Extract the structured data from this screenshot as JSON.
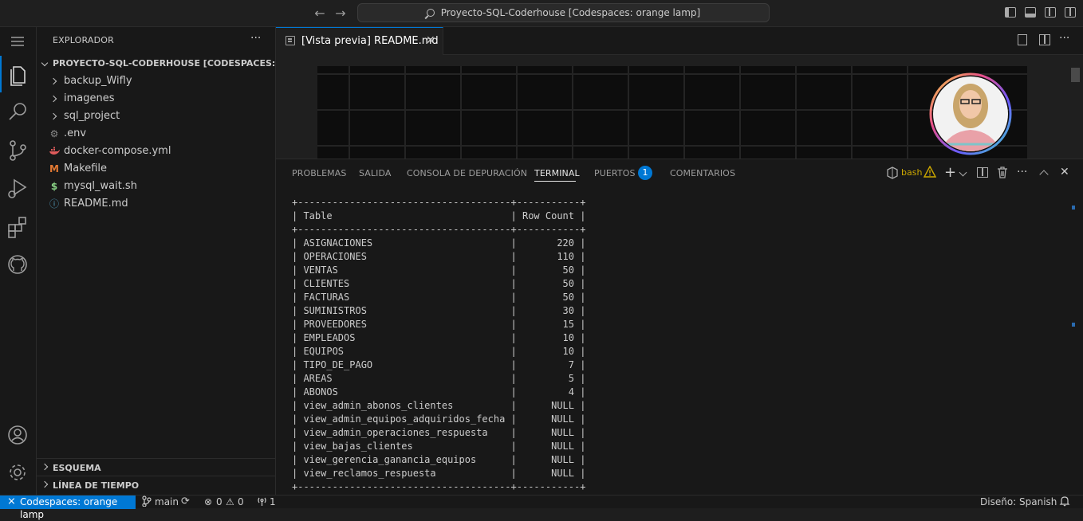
{
  "titlebar": {
    "search_text": "Proyecto-SQL-Coderhouse [Codespaces: orange lamp]"
  },
  "sidebar": {
    "title": "EXPLORADOR",
    "more": "···",
    "root_folder": "PROYECTO-SQL-CODERHOUSE [CODESPACES: ORA...",
    "items": [
      {
        "label": "backup_Wifly",
        "type": "folder"
      },
      {
        "label": "imagenes",
        "type": "folder"
      },
      {
        "label": "sql_project",
        "type": "folder"
      },
      {
        "label": ".env",
        "type": "gear-icon"
      },
      {
        "label": "docker-compose.yml",
        "type": "docker-icon"
      },
      {
        "label": "Makefile",
        "type": "makefile-icon",
        "glyph": "M"
      },
      {
        "label": "mysql_wait.sh",
        "type": "shell-icon",
        "glyph": "$"
      },
      {
        "label": "README.md",
        "type": "info-icon",
        "glyph": "ⓘ"
      }
    ],
    "outline": "ESQUEMA",
    "timeline": "LÍNEA DE TIEMPO"
  },
  "editor": {
    "tab_label": "[Vista previa] README.md",
    "tab_close": "✕"
  },
  "panel": {
    "tabs": [
      "PROBLEMAS",
      "SALIDA",
      "CONSOLA DE DEPURACIÓN",
      "TERMINAL",
      "PUERTOS",
      "COMENTARIOS"
    ],
    "ports_count": "1",
    "shell_name": "bash"
  },
  "terminal": {
    "border": "+-------------------------------------+-----------+",
    "header": [
      "Table",
      "Row Count"
    ],
    "rows": [
      [
        "ASIGNACIONES",
        "220"
      ],
      [
        "OPERACIONES",
        "110"
      ],
      [
        "VENTAS",
        "50"
      ],
      [
        "CLIENTES",
        "50"
      ],
      [
        "FACTURAS",
        "50"
      ],
      [
        "SUMINISTROS",
        "30"
      ],
      [
        "PROVEEDORES",
        "15"
      ],
      [
        "EMPLEADOS",
        "10"
      ],
      [
        "EQUIPOS",
        "10"
      ],
      [
        "TIPO_DE_PAGO",
        "7"
      ],
      [
        "AREAS",
        "5"
      ],
      [
        "ABONOS",
        "4"
      ],
      [
        "view_admin_abonos_clientes",
        "NULL"
      ],
      [
        "view_admin_equipos_adquiridos_fecha",
        "NULL"
      ],
      [
        "view_admin_operaciones_respuesta",
        "NULL"
      ],
      [
        "view_bajas_clientes",
        "NULL"
      ],
      [
        "view_gerencia_ganancia_equipos",
        "NULL"
      ],
      [
        "view_reclamos_respuesta",
        "NULL"
      ]
    ]
  },
  "statusbar": {
    "remote": "Codespaces: orange lamp",
    "branch": "main",
    "errors": "0",
    "warnings": "0",
    "ports": "1",
    "layout": "Diseño: Spanish"
  },
  "colors": {
    "accent": "#0078d4",
    "warning": "#cca700",
    "docker": "#e05b5b",
    "makefile": "#e37933",
    "shell": "#89d185",
    "info": "#519aba"
  }
}
